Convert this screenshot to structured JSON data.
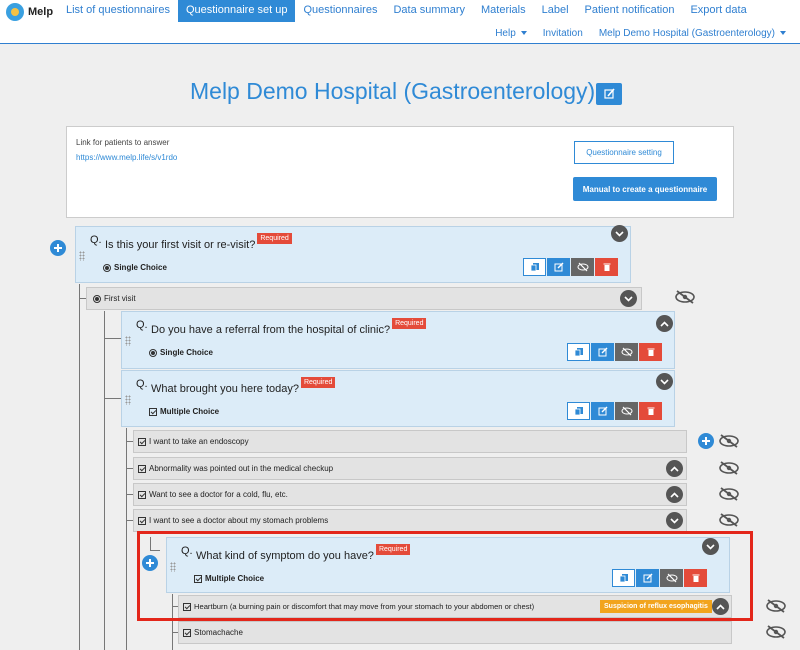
{
  "app": {
    "name": "Melp"
  },
  "nav": {
    "primary": [
      {
        "label": "List of questionnaires",
        "active": false
      },
      {
        "label": "Questionnaire set up",
        "active": true
      },
      {
        "label": "Questionnaires",
        "active": false
      },
      {
        "label": "Data summary",
        "active": false
      },
      {
        "label": "Materials",
        "active": false
      },
      {
        "label": "Label",
        "active": false
      },
      {
        "label": "Patient notification",
        "active": false
      },
      {
        "label": "Export data",
        "active": false
      }
    ],
    "secondary": [
      {
        "label": "Help",
        "dropdown": true
      },
      {
        "label": "Invitation",
        "dropdown": false
      },
      {
        "label": "Melp Demo Hospital (Gastroenterology)",
        "dropdown": true
      }
    ]
  },
  "page": {
    "title": "Melp Demo Hospital (Gastroenterology)"
  },
  "link_panel": {
    "label": "Link for patients to answer",
    "url": "https://www.melp.life/s/v1rdo",
    "setting_button": "Questionnaire setting",
    "manual_button": "Manual to create a questionnaire"
  },
  "questions": {
    "q1": {
      "mark": "Q.",
      "text": "Is this your first visit or re-visit?",
      "required": "Required",
      "type": "Single Choice",
      "chevron": "down"
    },
    "q2": {
      "mark": "Q.",
      "text": "Do you have a referral from the hospital of clinic?",
      "required": "Required",
      "type": "Single Choice",
      "chevron": "up"
    },
    "q3": {
      "mark": "Q.",
      "text": "What brought you here today?",
      "required": "Required",
      "type": "Multiple Choice",
      "chevron": "down"
    },
    "q4": {
      "mark": "Q.",
      "text": "What kind of symptom do you have?",
      "required": "Required",
      "type": "Multiple Choice",
      "chevron": "down"
    }
  },
  "options": {
    "first_visit": {
      "text": "First visit"
    },
    "o1": {
      "text": "I want to take an endoscopy"
    },
    "o2": {
      "text": "Abnormality was pointed out in the medical checkup"
    },
    "o3": {
      "text": "Want to see a doctor for a cold, flu, etc."
    },
    "o4": {
      "text": "I want to see a doctor about my stomach problems"
    },
    "s1": {
      "text": "Heartburn (a burning pain or discomfort that may move from your stomach to your abdomen or chest)",
      "tag": "Suspicion of reflux esophagitis"
    },
    "s2": {
      "text": "Stomachache"
    }
  },
  "colors": {
    "primary": "#2f8ad6",
    "danger": "#e44b3a",
    "tag": "#f2a41d",
    "highlight": "#e3261a"
  },
  "icons": {
    "copy": "copy-icon",
    "edit": "edit-icon",
    "hide": "eye-off-icon",
    "delete": "trash-icon",
    "add": "plus-circle-icon",
    "chevron": "chevron-icon"
  }
}
